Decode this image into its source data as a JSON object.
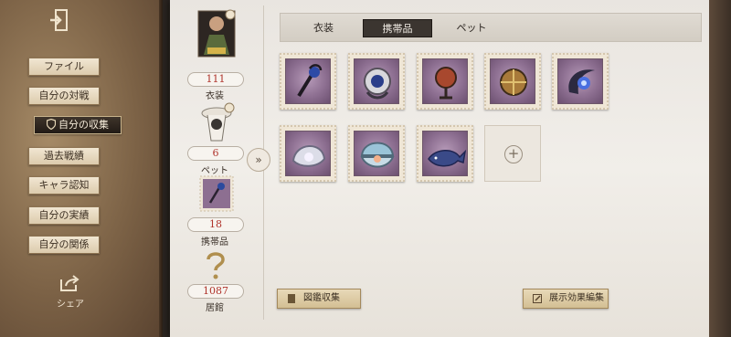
{
  "sidebar": {
    "items": [
      {
        "label": "ファイル"
      },
      {
        "label": "自分の対戦"
      },
      {
        "label": "自分の収集"
      },
      {
        "label": "過去戦績"
      },
      {
        "label": "キャラ認知"
      },
      {
        "label": "自分の実績"
      },
      {
        "label": "自分の関係"
      }
    ],
    "active_index": 2,
    "share_label": "シェア"
  },
  "stats": [
    {
      "value": "111",
      "label": "衣装"
    },
    {
      "value": "6",
      "label": "ペット"
    },
    {
      "value": "18",
      "label": "携帯品"
    },
    {
      "value": "1087",
      "label": "居館"
    }
  ],
  "tabs": [
    {
      "label": "衣装"
    },
    {
      "label": "携帯品"
    },
    {
      "label": "ペット"
    }
  ],
  "active_tab": "携帯品",
  "items": [
    {
      "icon": "umbrella-cane-icon"
    },
    {
      "icon": "lantern-ornament-icon"
    },
    {
      "icon": "red-orb-lantern-icon"
    },
    {
      "icon": "golden-sphere-icon"
    },
    {
      "icon": "blue-crescent-orb-icon"
    },
    {
      "icon": "pearl-shell-icon"
    },
    {
      "icon": "open-clam-icon"
    },
    {
      "icon": "whale-icon"
    }
  ],
  "buttons": {
    "collection_book": "図鑑収集",
    "edit_display": "展示効果編集"
  },
  "colors": {
    "stamp_purple": "#8d6f91",
    "stat_red": "#b0342c",
    "active_tab": "#3b3530"
  }
}
